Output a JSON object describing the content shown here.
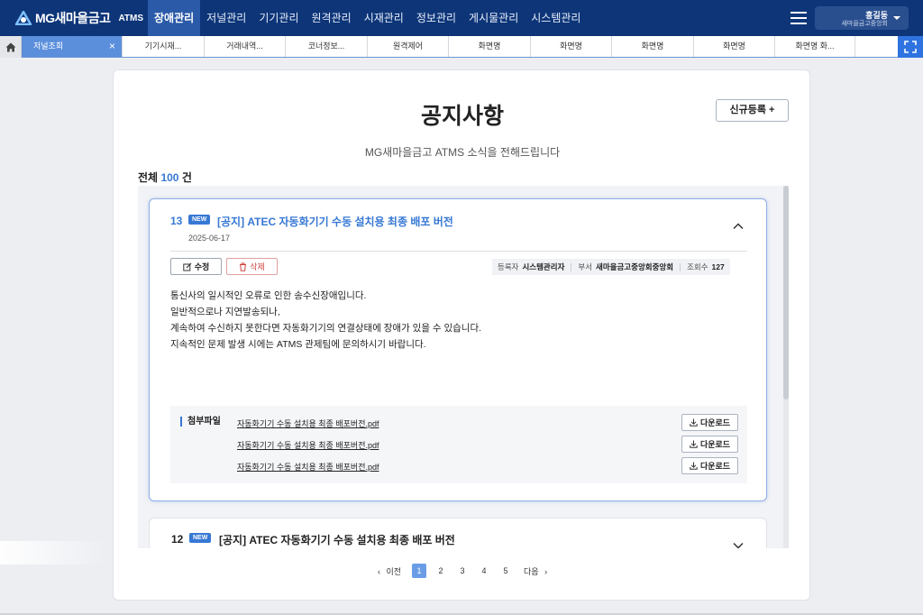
{
  "app": {
    "brand": "MG새마을금고",
    "system": "ATMS",
    "colors": {
      "nav_bg": "#0d3578",
      "accent": "#3778d4",
      "active_tab": "#5b8fdc"
    }
  },
  "topnav": {
    "items": [
      {
        "label": "장애관리",
        "active": true
      },
      {
        "label": "저널관리"
      },
      {
        "label": "기기관리"
      },
      {
        "label": "원격관리"
      },
      {
        "label": "시재관리"
      },
      {
        "label": "정보관리"
      },
      {
        "label": "게시물관리"
      },
      {
        "label": "시스템관리"
      }
    ],
    "menu_icon": "hamburger-icon"
  },
  "user": {
    "name": "홍길동",
    "org": "새마을금고중앙회"
  },
  "tabs": {
    "home_icon": "home-icon",
    "items": [
      {
        "label": "저널조회",
        "active": true
      },
      {
        "label": "기기시재..."
      },
      {
        "label": "거래내역..."
      },
      {
        "label": "코너정보..."
      },
      {
        "label": "원격제어"
      },
      {
        "label": "화면명"
      },
      {
        "label": "화면명"
      },
      {
        "label": "화면명"
      },
      {
        "label": "화면명"
      },
      {
        "label": "화면명 화..."
      }
    ],
    "close_glyph": "×",
    "expand_icon": "fullscreen-icon"
  },
  "notice_page": {
    "title": "공지사항",
    "new_button": "신규등록 +",
    "subtitle": "MG새마을금고 ATMS 소식을 전해드립니다",
    "total_prefix": "전체",
    "total_count": "100",
    "total_suffix": "건"
  },
  "notices": [
    {
      "number": "13",
      "badge": "NEW",
      "title": "[공지] ATEC 자동화기기 수동 설치용 최종 배포 버전",
      "date": "2025-06-17",
      "expanded": true,
      "edit_label": "수정",
      "delete_label": "삭제",
      "meta": {
        "author_label": "등록자",
        "author": "시스템관리자",
        "dept_label": "부서",
        "dept": "새마을금고중앙회중앙회",
        "views_label": "조회수",
        "views": "127"
      },
      "body": [
        "통신사의 일시적인 오류로 인한 송수신장애입니다.",
        "일반적으로나 지연발송되나,",
        "계속하여 수신하지 못한다면 자동화기기의 연결상태에 장애가 있을 수 있습니다.",
        "지속적인 문제 발생 시에는 ATMS 관제팀에 문의하시기 바랍니다."
      ],
      "attachment_label": "첨부파일",
      "attachments": [
        {
          "name": "자동화기기 수동 설치용 최종 배포버전.pdf",
          "download": "다운로드"
        },
        {
          "name": "자동화기기 수동 설치용 최종 배포버전.pdf",
          "download": "다운로드"
        },
        {
          "name": "자동화기기 수동 설치용 최종 배포버전.pdf",
          "download": "다운로드"
        }
      ]
    },
    {
      "number": "12",
      "badge": "NEW",
      "title": "[공지] ATEC 자동화기기 수동 설치용 최종 배포 버전",
      "expanded": false
    }
  ],
  "pagination": {
    "prev": "이전",
    "next": "다음",
    "pages": [
      "1",
      "2",
      "3",
      "4",
      "5"
    ],
    "current": "1"
  }
}
